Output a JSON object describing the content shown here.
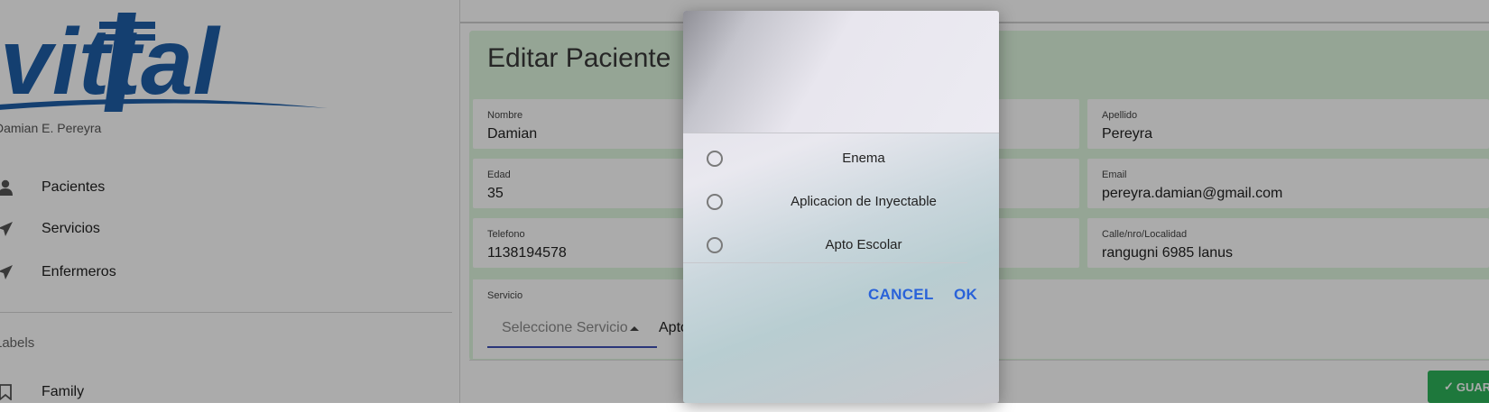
{
  "app": {
    "logo_text": "vittal",
    "user_name": "Damian E. Pereyra"
  },
  "sidebar": {
    "items": [
      {
        "label": "Pacientes",
        "icon": "person-icon"
      },
      {
        "label": "Servicios",
        "icon": "send-icon"
      },
      {
        "label": "Enfermeros",
        "icon": "send-icon"
      }
    ],
    "section_title": "Labels",
    "labels": [
      {
        "label": "Family",
        "icon": "label-icon"
      }
    ]
  },
  "page": {
    "title": "Editar Paciente",
    "fields": {
      "nombre": {
        "label": "Nombre",
        "value": "Damian"
      },
      "apellido": {
        "label": "Apellido",
        "value": "Pereyra"
      },
      "edad": {
        "label": "Edad",
        "value": "35"
      },
      "email": {
        "label": "Email",
        "value": "pereyra.damian@gmail.com"
      },
      "telefono": {
        "label": "Telefono",
        "value": "1138194578"
      },
      "direccion": {
        "label": "Calle/nro/Localidad",
        "value": "rangugni 6985 lanus"
      }
    },
    "servicio": {
      "label": "Servicio",
      "placeholder": "Seleccione Servicio",
      "chip": "Apto Escolar"
    },
    "save_label": "GUARDAR"
  },
  "dialog": {
    "options": [
      "Enema",
      "Aplicacion de Inyectable",
      "Apto Escolar"
    ],
    "cancel_label": "CANCEL",
    "ok_label": "OK"
  },
  "colors": {
    "brand": "#1f5fa8",
    "accent": "#3f51b5",
    "dialog_button": "#2962d9",
    "save": "#2eb35a",
    "card": "#def7de"
  }
}
